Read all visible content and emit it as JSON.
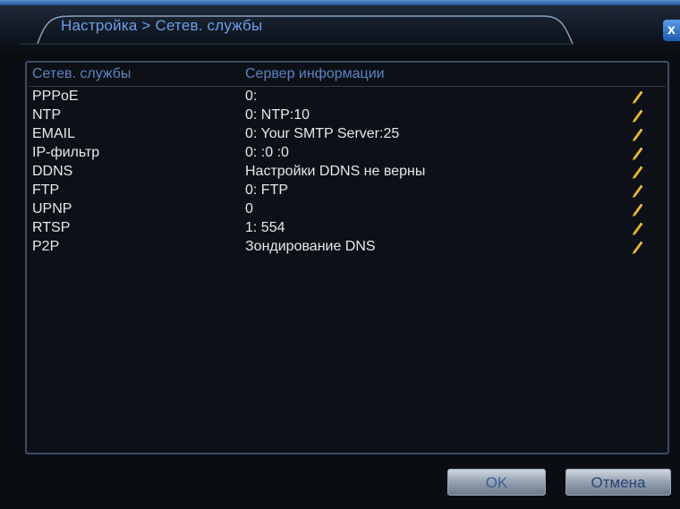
{
  "window": {
    "title": "Настройка > Сетев. службы",
    "close_label": "x"
  },
  "table": {
    "headers": [
      "Сетев. службы",
      "Сервер информации"
    ],
    "rows": [
      {
        "name": "PPPoE",
        "info": "0:"
      },
      {
        "name": "NTP",
        "info": "0: NTP:10"
      },
      {
        "name": "EMAIL",
        "info": "0: Your SMTP Server:25"
      },
      {
        "name": "IP-фильтр",
        "info": "0: :0 :0"
      },
      {
        "name": "DDNS",
        "info": "Настройки DDNS не верны"
      },
      {
        "name": "FTP",
        "info": "0: FTP"
      },
      {
        "name": "UPNP",
        "info": "0"
      },
      {
        "name": "RTSP",
        "info": "1: 554"
      },
      {
        "name": "P2P",
        "info": "Зондирование DNS"
      }
    ],
    "edit_icon": "pencil-icon"
  },
  "footer": {
    "ok_label": "OK",
    "cancel_label": "Отмена"
  },
  "colors": {
    "accent": "#6c9ee8",
    "header_text": "#5c83c0",
    "row_text": "#e6e8ec",
    "pencil": "#e8b830",
    "background": "#0a0d12"
  }
}
